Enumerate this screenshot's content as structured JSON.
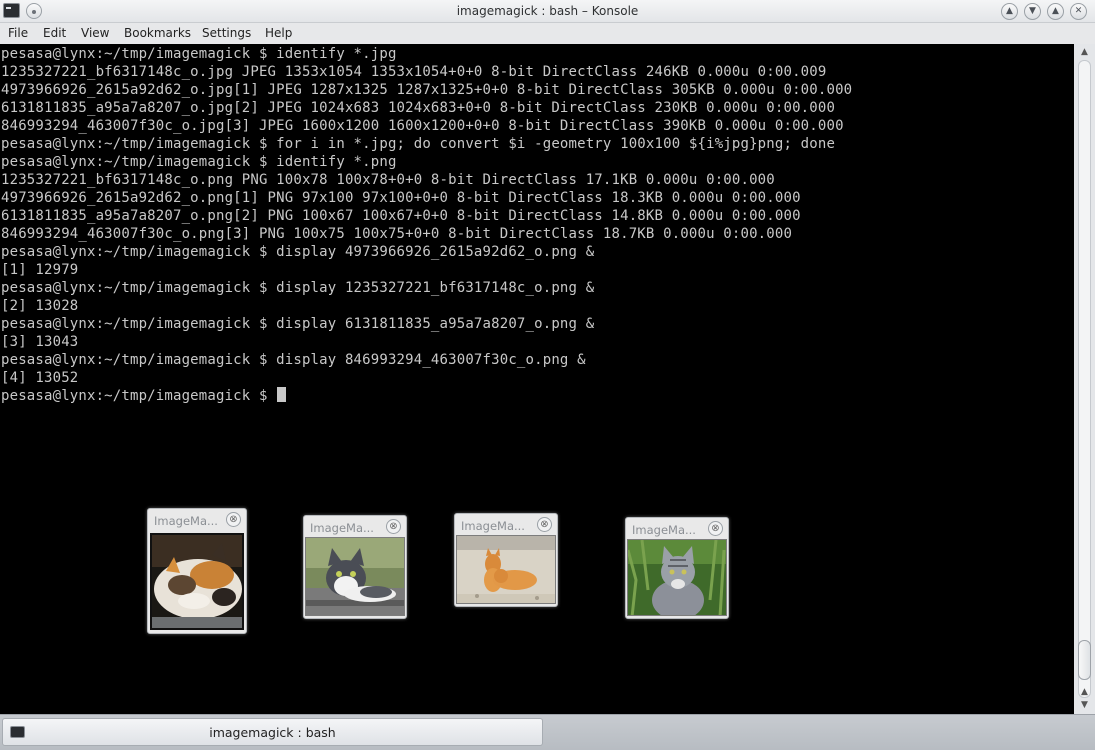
{
  "window": {
    "title": "imagemagick : bash – Konsole",
    "buttons": [
      "keep-above",
      "minimize",
      "maximize",
      "close"
    ]
  },
  "menubar": {
    "items": [
      "File",
      "Edit",
      "View",
      "Bookmarks",
      "Settings",
      "Help"
    ]
  },
  "terminal": {
    "lines": [
      "pesasa@lynx:~/tmp/imagemagick $ identify *.jpg",
      "1235327221_bf6317148c_o.jpg JPEG 1353x1054 1353x1054+0+0 8-bit DirectClass 246KB 0.000u 0:00.009",
      "4973966926_2615a92d62_o.jpg[1] JPEG 1287x1325 1287x1325+0+0 8-bit DirectClass 305KB 0.000u 0:00.000",
      "6131811835_a95a7a8207_o.jpg[2] JPEG 1024x683 1024x683+0+0 8-bit DirectClass 230KB 0.000u 0:00.000",
      "846993294_463007f30c_o.jpg[3] JPEG 1600x1200 1600x1200+0+0 8-bit DirectClass 390KB 0.000u 0:00.000",
      "pesasa@lynx:~/tmp/imagemagick $ for i in *.jpg; do convert $i -geometry 100x100 ${i%jpg}png; done",
      "pesasa@lynx:~/tmp/imagemagick $ identify *.png",
      "1235327221_bf6317148c_o.png PNG 100x78 100x78+0+0 8-bit DirectClass 17.1KB 0.000u 0:00.000",
      "4973966926_2615a92d62_o.png[1] PNG 97x100 97x100+0+0 8-bit DirectClass 18.3KB 0.000u 0:00.000",
      "6131811835_a95a7a8207_o.png[2] PNG 100x67 100x67+0+0 8-bit DirectClass 14.8KB 0.000u 0:00.000",
      "846993294_463007f30c_o.png[3] PNG 100x75 100x75+0+0 8-bit DirectClass 18.7KB 0.000u 0:00.000",
      "pesasa@lynx:~/tmp/imagemagick $ display 4973966926_2615a92d62_o.png &",
      "[1] 12979",
      "pesasa@lynx:~/tmp/imagemagick $ display 1235327221_bf6317148c_o.png &",
      "[2] 13028",
      "pesasa@lynx:~/tmp/imagemagick $ display 6131811835_a95a7a8207_o.png &",
      "[3] 13043",
      "pesasa@lynx:~/tmp/imagemagick $ display 846993294_463007f30c_o.png &",
      "[4] 13052"
    ],
    "prompt": "pesasa@lynx:~/tmp/imagemagick $ "
  },
  "image_windows": [
    {
      "title": "ImageMa...",
      "close_glyph": "⊗"
    },
    {
      "title": "ImageMa...",
      "close_glyph": "⊗"
    },
    {
      "title": "ImageMa...",
      "close_glyph": "⊗"
    },
    {
      "title": "ImageMa...",
      "close_glyph": "⊗"
    }
  ],
  "taskbar": {
    "task_label": "imagemagick : bash"
  },
  "colors": {
    "terminal_bg": "#000000",
    "terminal_fg": "#c8c8c8"
  }
}
